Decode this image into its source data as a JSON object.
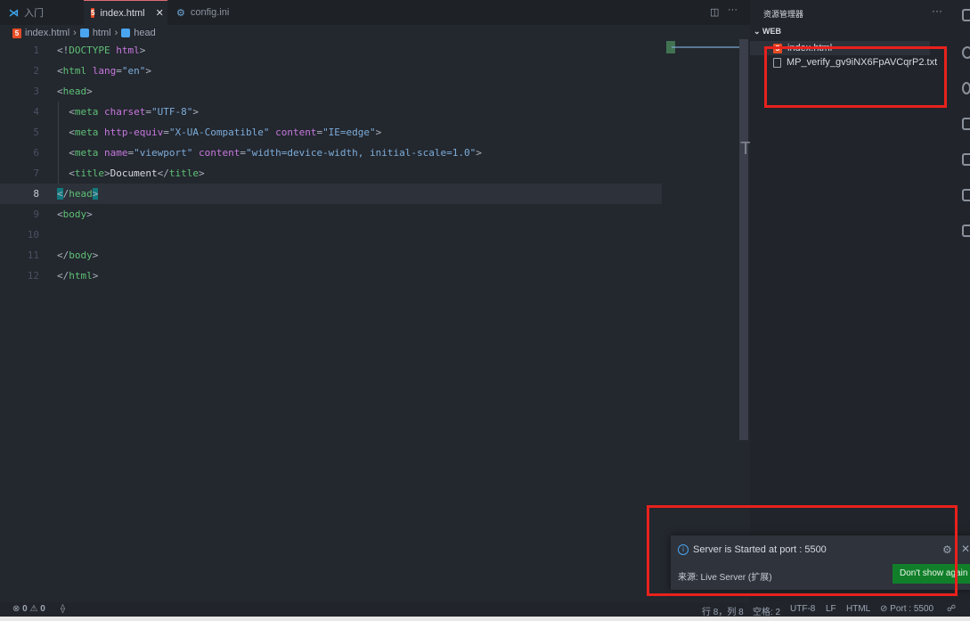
{
  "tabs": [
    {
      "label": "入门",
      "icon": "vscode-logo-icon"
    },
    {
      "label": "index.html",
      "icon": "html5-icon",
      "active": true
    },
    {
      "label": "config.ini",
      "icon": "gear-icon"
    }
  ],
  "breadcrumb": [
    "index.html",
    "html",
    "head"
  ],
  "editor": {
    "current_line": 8,
    "lines": [
      [
        [
          "<!",
          "p"
        ],
        [
          "DOCTYPE",
          "t"
        ],
        [
          " html",
          "a"
        ],
        [
          ">",
          "p"
        ]
      ],
      [
        [
          "<",
          "p"
        ],
        [
          "html",
          "t"
        ],
        [
          " lang",
          "a"
        ],
        [
          "=",
          "p"
        ],
        [
          "\"en\"",
          "s"
        ],
        [
          ">",
          "p"
        ]
      ],
      [
        [
          "<",
          "p"
        ],
        [
          "head",
          "t"
        ],
        [
          ">",
          "p"
        ]
      ],
      [
        [
          "  <",
          "p"
        ],
        [
          "meta",
          "t"
        ],
        [
          " charset",
          "a"
        ],
        [
          "=",
          "p"
        ],
        [
          "\"UTF-8\"",
          "s"
        ],
        [
          ">",
          "p"
        ]
      ],
      [
        [
          "  <",
          "p"
        ],
        [
          "meta",
          "t"
        ],
        [
          " http-equiv",
          "a"
        ],
        [
          "=",
          "p"
        ],
        [
          "\"X-UA-Compatible\"",
          "s"
        ],
        [
          " content",
          "a"
        ],
        [
          "=",
          "p"
        ],
        [
          "\"IE=edge\"",
          "s"
        ],
        [
          ">",
          "p"
        ]
      ],
      [
        [
          "  <",
          "p"
        ],
        [
          "meta",
          "t"
        ],
        [
          " name",
          "a"
        ],
        [
          "=",
          "p"
        ],
        [
          "\"viewport\"",
          "s"
        ],
        [
          " content",
          "a"
        ],
        [
          "=",
          "p"
        ],
        [
          "\"width=device-width, initial-scale=1.0\"",
          "s"
        ],
        [
          ">",
          "p"
        ]
      ],
      [
        [
          "  <",
          "p"
        ],
        [
          "title",
          "t"
        ],
        [
          ">",
          "p"
        ],
        [
          "Document",
          "x"
        ],
        [
          "</",
          "p"
        ],
        [
          "title",
          "t"
        ],
        [
          ">",
          "p"
        ]
      ],
      [
        [
          "<",
          "hl"
        ],
        [
          "/",
          "p"
        ],
        [
          "head",
          "t"
        ],
        [
          ">",
          "hl"
        ]
      ],
      [
        [
          "<",
          "p"
        ],
        [
          "body",
          "t"
        ],
        [
          ">",
          "p"
        ]
      ],
      [],
      [
        [
          "</",
          "p"
        ],
        [
          "body",
          "t"
        ],
        [
          ">",
          "p"
        ]
      ],
      [
        [
          "</",
          "p"
        ],
        [
          "html",
          "t"
        ],
        [
          ">",
          "p"
        ]
      ]
    ]
  },
  "explorer": {
    "title": "资源管理器",
    "folder": "WEB",
    "files": [
      {
        "name": "index.html",
        "icon": "html5-icon"
      },
      {
        "name": "MP_verify_gv9iNX6FpAVCqrP2.txt",
        "icon": "file-icon"
      }
    ]
  },
  "notification": {
    "message": "Server is Started at port : 5500",
    "source": "来源: Live Server (扩展)",
    "button": "Don't show again"
  },
  "status": {
    "errors": "0",
    "warnings": "0",
    "position": "行 8，列 8",
    "spaces": "空格: 2",
    "encoding": "UTF-8",
    "eol": "LF",
    "language": "HTML",
    "port": "Port : 5500"
  },
  "colors": {
    "highlight_box": "#e8211c",
    "button": "#117f2a",
    "accent": "#4aa5f0"
  }
}
